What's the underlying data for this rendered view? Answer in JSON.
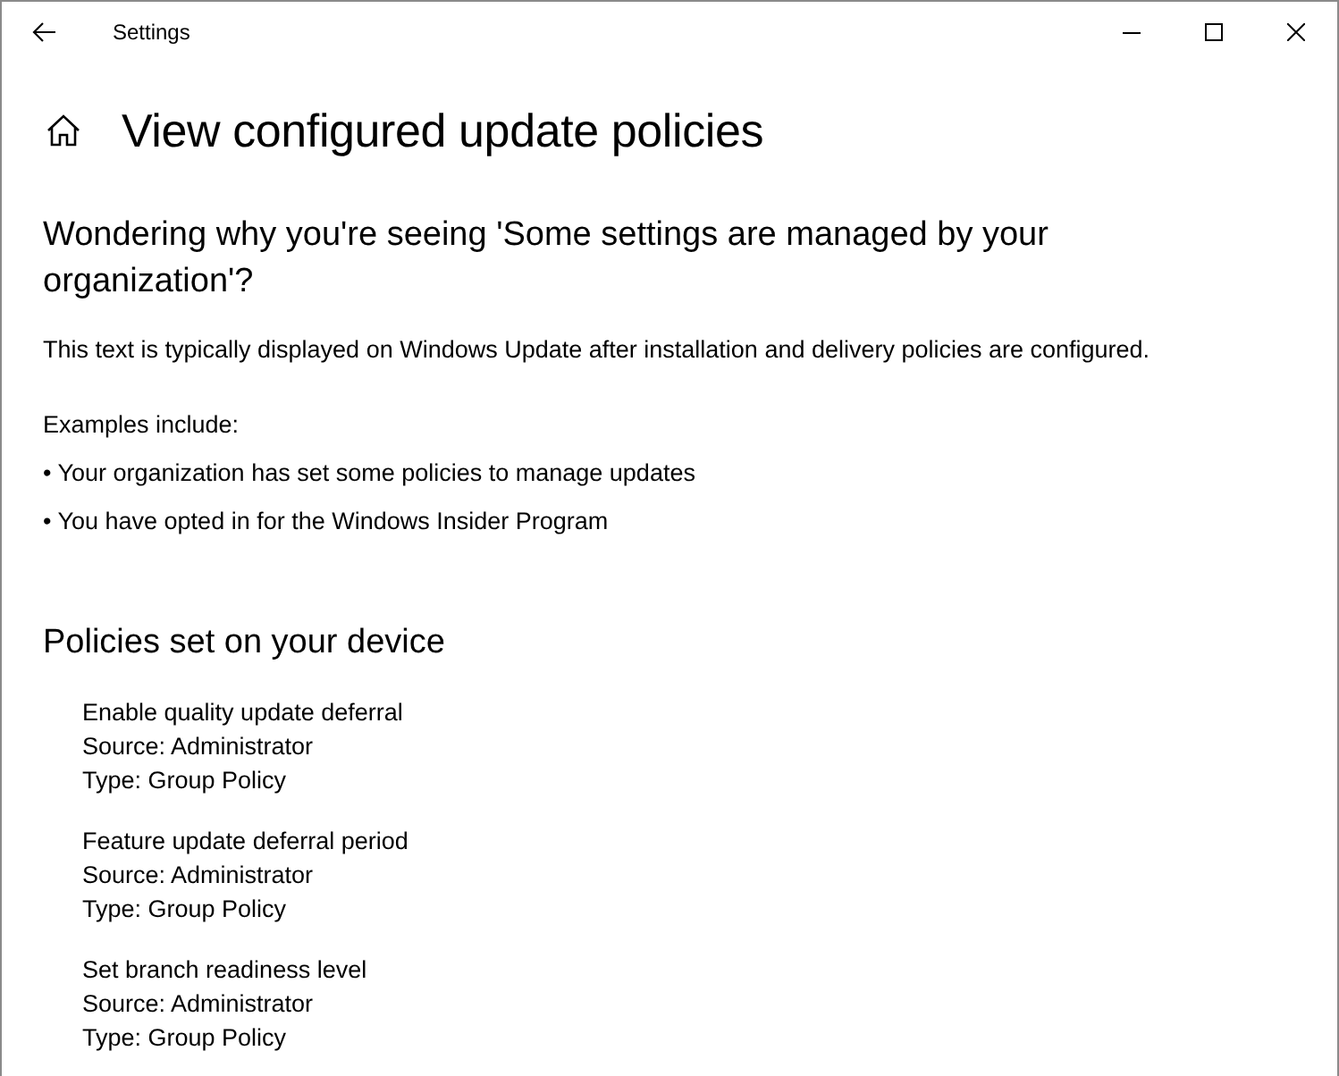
{
  "window": {
    "title": "Settings"
  },
  "page": {
    "title": "View configured update policies"
  },
  "intro": {
    "heading": "Wondering why you're seeing 'Some settings are managed by your organization'?",
    "description": "This text is typically displayed on Windows Update after installation and delivery policies are configured.",
    "examples_label": "Examples include:",
    "examples": [
      "• Your organization has set some policies to manage updates",
      "• You have opted in for the Windows Insider Program"
    ]
  },
  "policies": {
    "heading": "Policies set on your device",
    "items": [
      {
        "name": "Enable quality update deferral",
        "source": "Source: Administrator",
        "type": "Type: Group Policy"
      },
      {
        "name": "Feature update deferral period",
        "source": "Source: Administrator",
        "type": "Type: Group Policy"
      },
      {
        "name": "Set branch readiness level",
        "source": "Source: Administrator",
        "type": "Type: Group Policy"
      }
    ]
  }
}
